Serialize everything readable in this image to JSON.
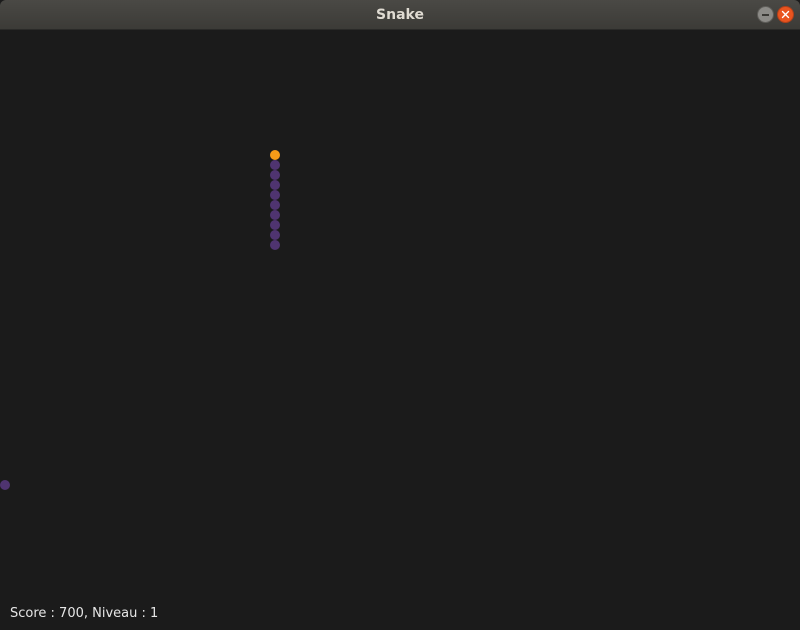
{
  "window": {
    "title": "Snake"
  },
  "game": {
    "score_label": "Score : 700, Niveau : 1",
    "score": 700,
    "level": 1,
    "colors": {
      "background": "#1b1b1b",
      "snake_head": "#f59b18",
      "snake_body": "#4f3470",
      "food": "#4f3470"
    },
    "snake_length": 10
  }
}
